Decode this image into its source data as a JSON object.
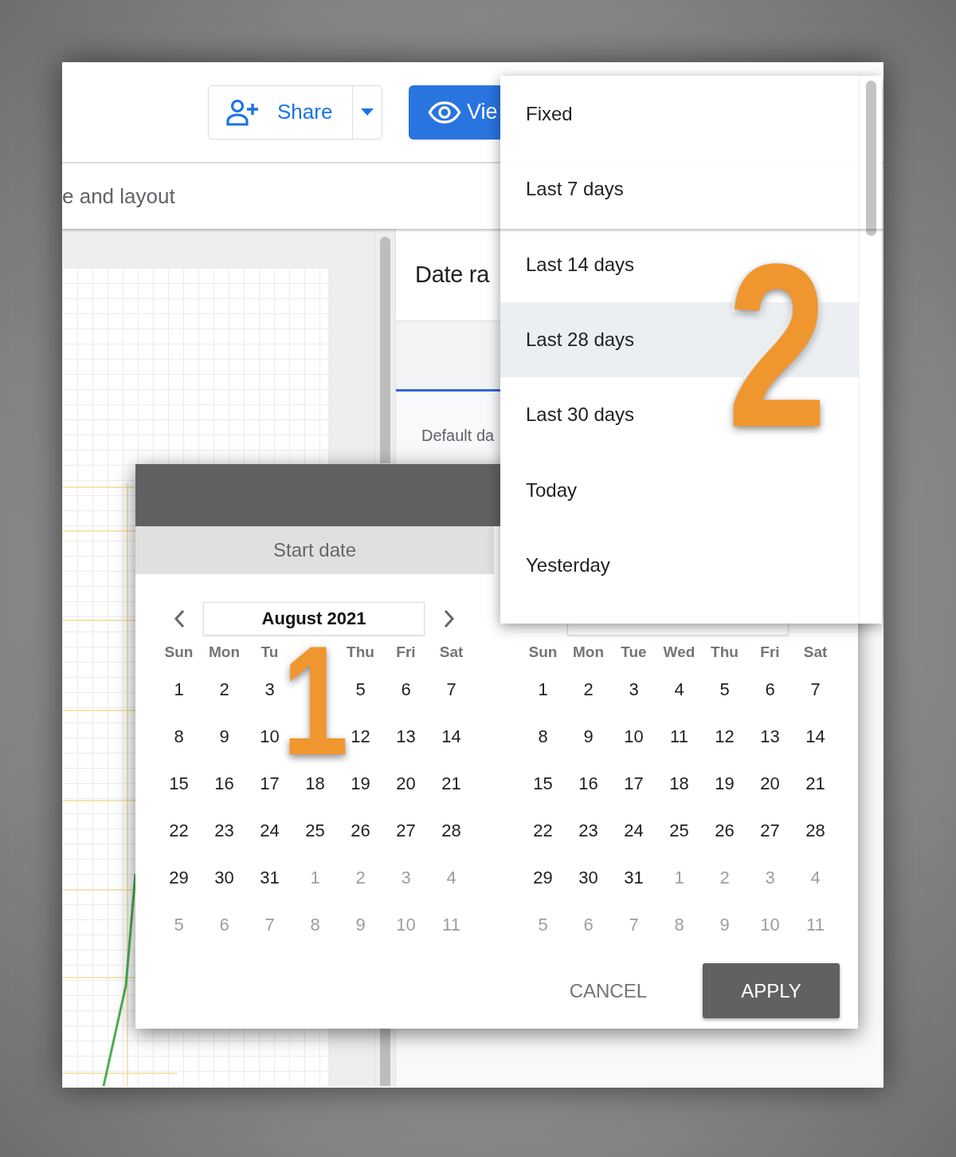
{
  "toolbar": {
    "share_button": "Share",
    "view_button": "Vie"
  },
  "tab_bar": {
    "label": "e and layout"
  },
  "panel": {
    "title": "Date ra",
    "field_label": "Default da"
  },
  "dialog": {
    "tab": "Start date",
    "calendars": [
      {
        "month": "August 2021",
        "weekdays": [
          {
            "label": "Sun"
          },
          {
            "label": "Mon"
          },
          {
            "label": "Tu"
          },
          {
            "covered": true
          },
          {
            "label": "Thu"
          },
          {
            "label": "Fri"
          },
          {
            "label": "Sat"
          }
        ],
        "weeks": [
          [
            {
              "d": "1",
              "muted": false
            },
            {
              "d": "2",
              "muted": false
            },
            {
              "d": "3",
              "muted": false
            },
            {
              "covered": true
            },
            {
              "d": "5",
              "muted": false
            },
            {
              "d": "6",
              "muted": false
            },
            {
              "d": "7",
              "muted": false
            }
          ],
          [
            {
              "d": "8",
              "muted": false
            },
            {
              "d": "9",
              "muted": false
            },
            {
              "d": "10",
              "muted": false
            },
            {
              "covered": true
            },
            {
              "d": "12",
              "muted": false
            },
            {
              "d": "13",
              "muted": false
            },
            {
              "d": "14",
              "muted": false
            }
          ],
          [
            {
              "d": "15",
              "muted": false
            },
            {
              "d": "16",
              "muted": false
            },
            {
              "d": "17",
              "muted": false
            },
            {
              "d": "18",
              "muted": false
            },
            {
              "d": "19",
              "muted": false
            },
            {
              "d": "20",
              "muted": false
            },
            {
              "d": "21",
              "muted": false
            }
          ],
          [
            {
              "d": "22",
              "muted": false
            },
            {
              "d": "23",
              "muted": false
            },
            {
              "d": "24",
              "muted": false
            },
            {
              "d": "25",
              "muted": false
            },
            {
              "d": "26",
              "muted": false
            },
            {
              "d": "27",
              "muted": false
            },
            {
              "d": "28",
              "muted": false
            }
          ],
          [
            {
              "d": "29",
              "muted": false
            },
            {
              "d": "30",
              "muted": false
            },
            {
              "d": "31",
              "muted": false
            },
            {
              "d": "1",
              "muted": true
            },
            {
              "d": "2",
              "muted": true
            },
            {
              "d": "3",
              "muted": true
            },
            {
              "d": "4",
              "muted": true
            }
          ],
          [
            {
              "d": "5",
              "muted": true
            },
            {
              "d": "6",
              "muted": true
            },
            {
              "d": "7",
              "muted": true
            },
            {
              "d": "8",
              "muted": true
            },
            {
              "d": "9",
              "muted": true
            },
            {
              "d": "10",
              "muted": true
            },
            {
              "d": "11",
              "muted": true
            }
          ]
        ]
      },
      {
        "weekdays": [
          {
            "label": "Sun"
          },
          {
            "label": "Mon"
          },
          {
            "label": "Tue"
          },
          {
            "label": "Wed"
          },
          {
            "label": "Thu"
          },
          {
            "label": "Fri"
          },
          {
            "label": "Sat"
          }
        ],
        "weeks": [
          [
            {
              "d": "1",
              "muted": false
            },
            {
              "d": "2",
              "muted": false
            },
            {
              "d": "3",
              "muted": false
            },
            {
              "d": "4",
              "muted": false
            },
            {
              "d": "5",
              "muted": false
            },
            {
              "d": "6",
              "muted": false
            },
            {
              "d": "7",
              "muted": false
            }
          ],
          [
            {
              "d": "8",
              "muted": false
            },
            {
              "d": "9",
              "muted": false
            },
            {
              "d": "10",
              "muted": false
            },
            {
              "d": "11",
              "muted": false
            },
            {
              "d": "12",
              "muted": false
            },
            {
              "d": "13",
              "muted": false
            },
            {
              "d": "14",
              "muted": false
            }
          ],
          [
            {
              "d": "15",
              "muted": false
            },
            {
              "d": "16",
              "muted": false
            },
            {
              "d": "17",
              "muted": false
            },
            {
              "d": "18",
              "muted": false
            },
            {
              "d": "19",
              "muted": false
            },
            {
              "d": "20",
              "muted": false
            },
            {
              "d": "21",
              "muted": false
            }
          ],
          [
            {
              "d": "22",
              "muted": false
            },
            {
              "d": "23",
              "muted": false
            },
            {
              "d": "24",
              "muted": false
            },
            {
              "d": "25",
              "muted": false
            },
            {
              "d": "26",
              "muted": false
            },
            {
              "d": "27",
              "muted": false
            },
            {
              "d": "28",
              "muted": false
            }
          ],
          [
            {
              "d": "29",
              "muted": false
            },
            {
              "d": "30",
              "muted": false
            },
            {
              "d": "31",
              "muted": false
            },
            {
              "d": "1",
              "muted": true
            },
            {
              "d": "2",
              "muted": true
            },
            {
              "d": "3",
              "muted": true
            },
            {
              "d": "4",
              "muted": true
            }
          ],
          [
            {
              "d": "5",
              "muted": true
            },
            {
              "d": "6",
              "muted": true
            },
            {
              "d": "7",
              "muted": true
            },
            {
              "d": "8",
              "muted": true
            },
            {
              "d": "9",
              "muted": true
            },
            {
              "d": "10",
              "muted": true
            },
            {
              "d": "11",
              "muted": true
            }
          ]
        ]
      }
    ],
    "buttons": [
      {
        "label": "CANCEL",
        "kind": "text"
      },
      {
        "label": "APPLY",
        "kind": "filled"
      }
    ]
  },
  "range_menu": {
    "items": [
      {
        "label": "Fixed",
        "selected": false
      },
      {
        "label": "Last 7 days",
        "selected": false
      },
      {
        "label": "Last 14 days",
        "selected": false
      },
      {
        "label": "Last 28 days",
        "selected": true
      },
      {
        "label": "Last 30 days",
        "selected": false
      },
      {
        "label": "Today",
        "selected": false
      },
      {
        "label": "Yesterday",
        "selected": false
      }
    ]
  },
  "annotations": [
    {
      "label": "1"
    },
    {
      "label": "2"
    }
  ]
}
